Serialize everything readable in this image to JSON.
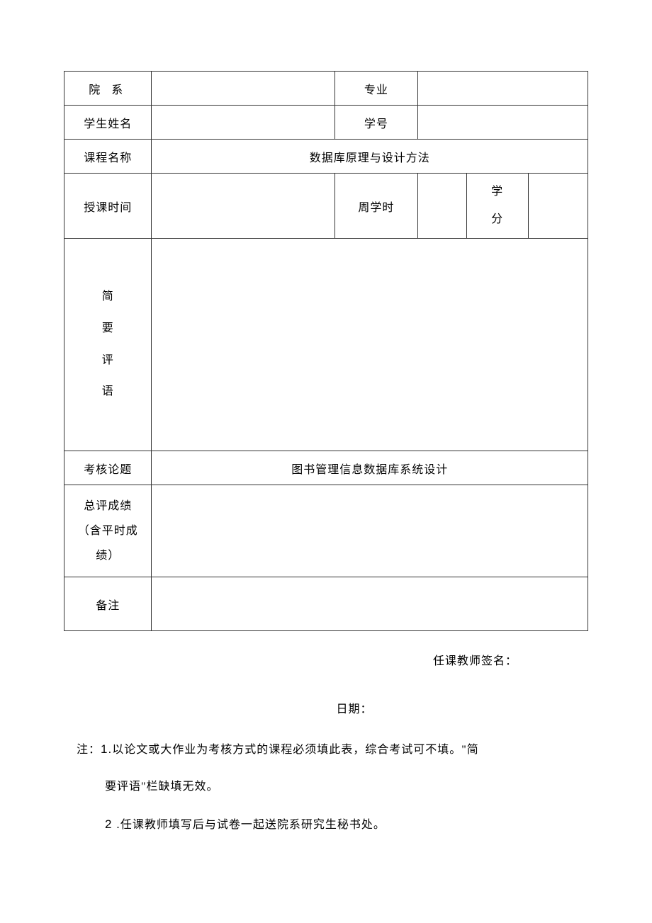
{
  "form": {
    "row1": {
      "label_dept": "院 系",
      "value_dept": "",
      "label_major": "专业",
      "value_major": ""
    },
    "row2": {
      "label_name": "学生姓名",
      "value_name": "",
      "label_id": "学号",
      "value_id": ""
    },
    "row3": {
      "label_course": "课程名称",
      "value_course": "数据库原理与设计方法"
    },
    "row4": {
      "label_time": "授课时间",
      "value_time": "",
      "label_weekly": "周学时",
      "value_weekly": "",
      "label_credit_char1": "学",
      "label_credit_char2": "分",
      "value_credit": ""
    },
    "row_comment": {
      "label_c1": "简",
      "label_c2": "要",
      "label_c3": "评",
      "label_c4": "语",
      "value": ""
    },
    "row_topic": {
      "label": "考核论题",
      "value": "图书管理信息数据库系统设计"
    },
    "row_grade": {
      "label_l1": "总评成绩",
      "label_l2": "（含平时成",
      "label_l3": "绩）",
      "value": ""
    },
    "row_remark": {
      "label": "备注",
      "value": ""
    }
  },
  "signature": "任课教师签名：",
  "date": "日期：",
  "notes": {
    "prefix": "注：",
    "num1": "1.",
    "text1a": "以论文或大作业为考核方式的课程必须填此表，综合考试可不填。\"简",
    "text1b": "要评语\"栏缺填无效。",
    "num2": "2 .",
    "text2": "任课教师填写后与试卷一起送院系研究生秘书处。"
  }
}
